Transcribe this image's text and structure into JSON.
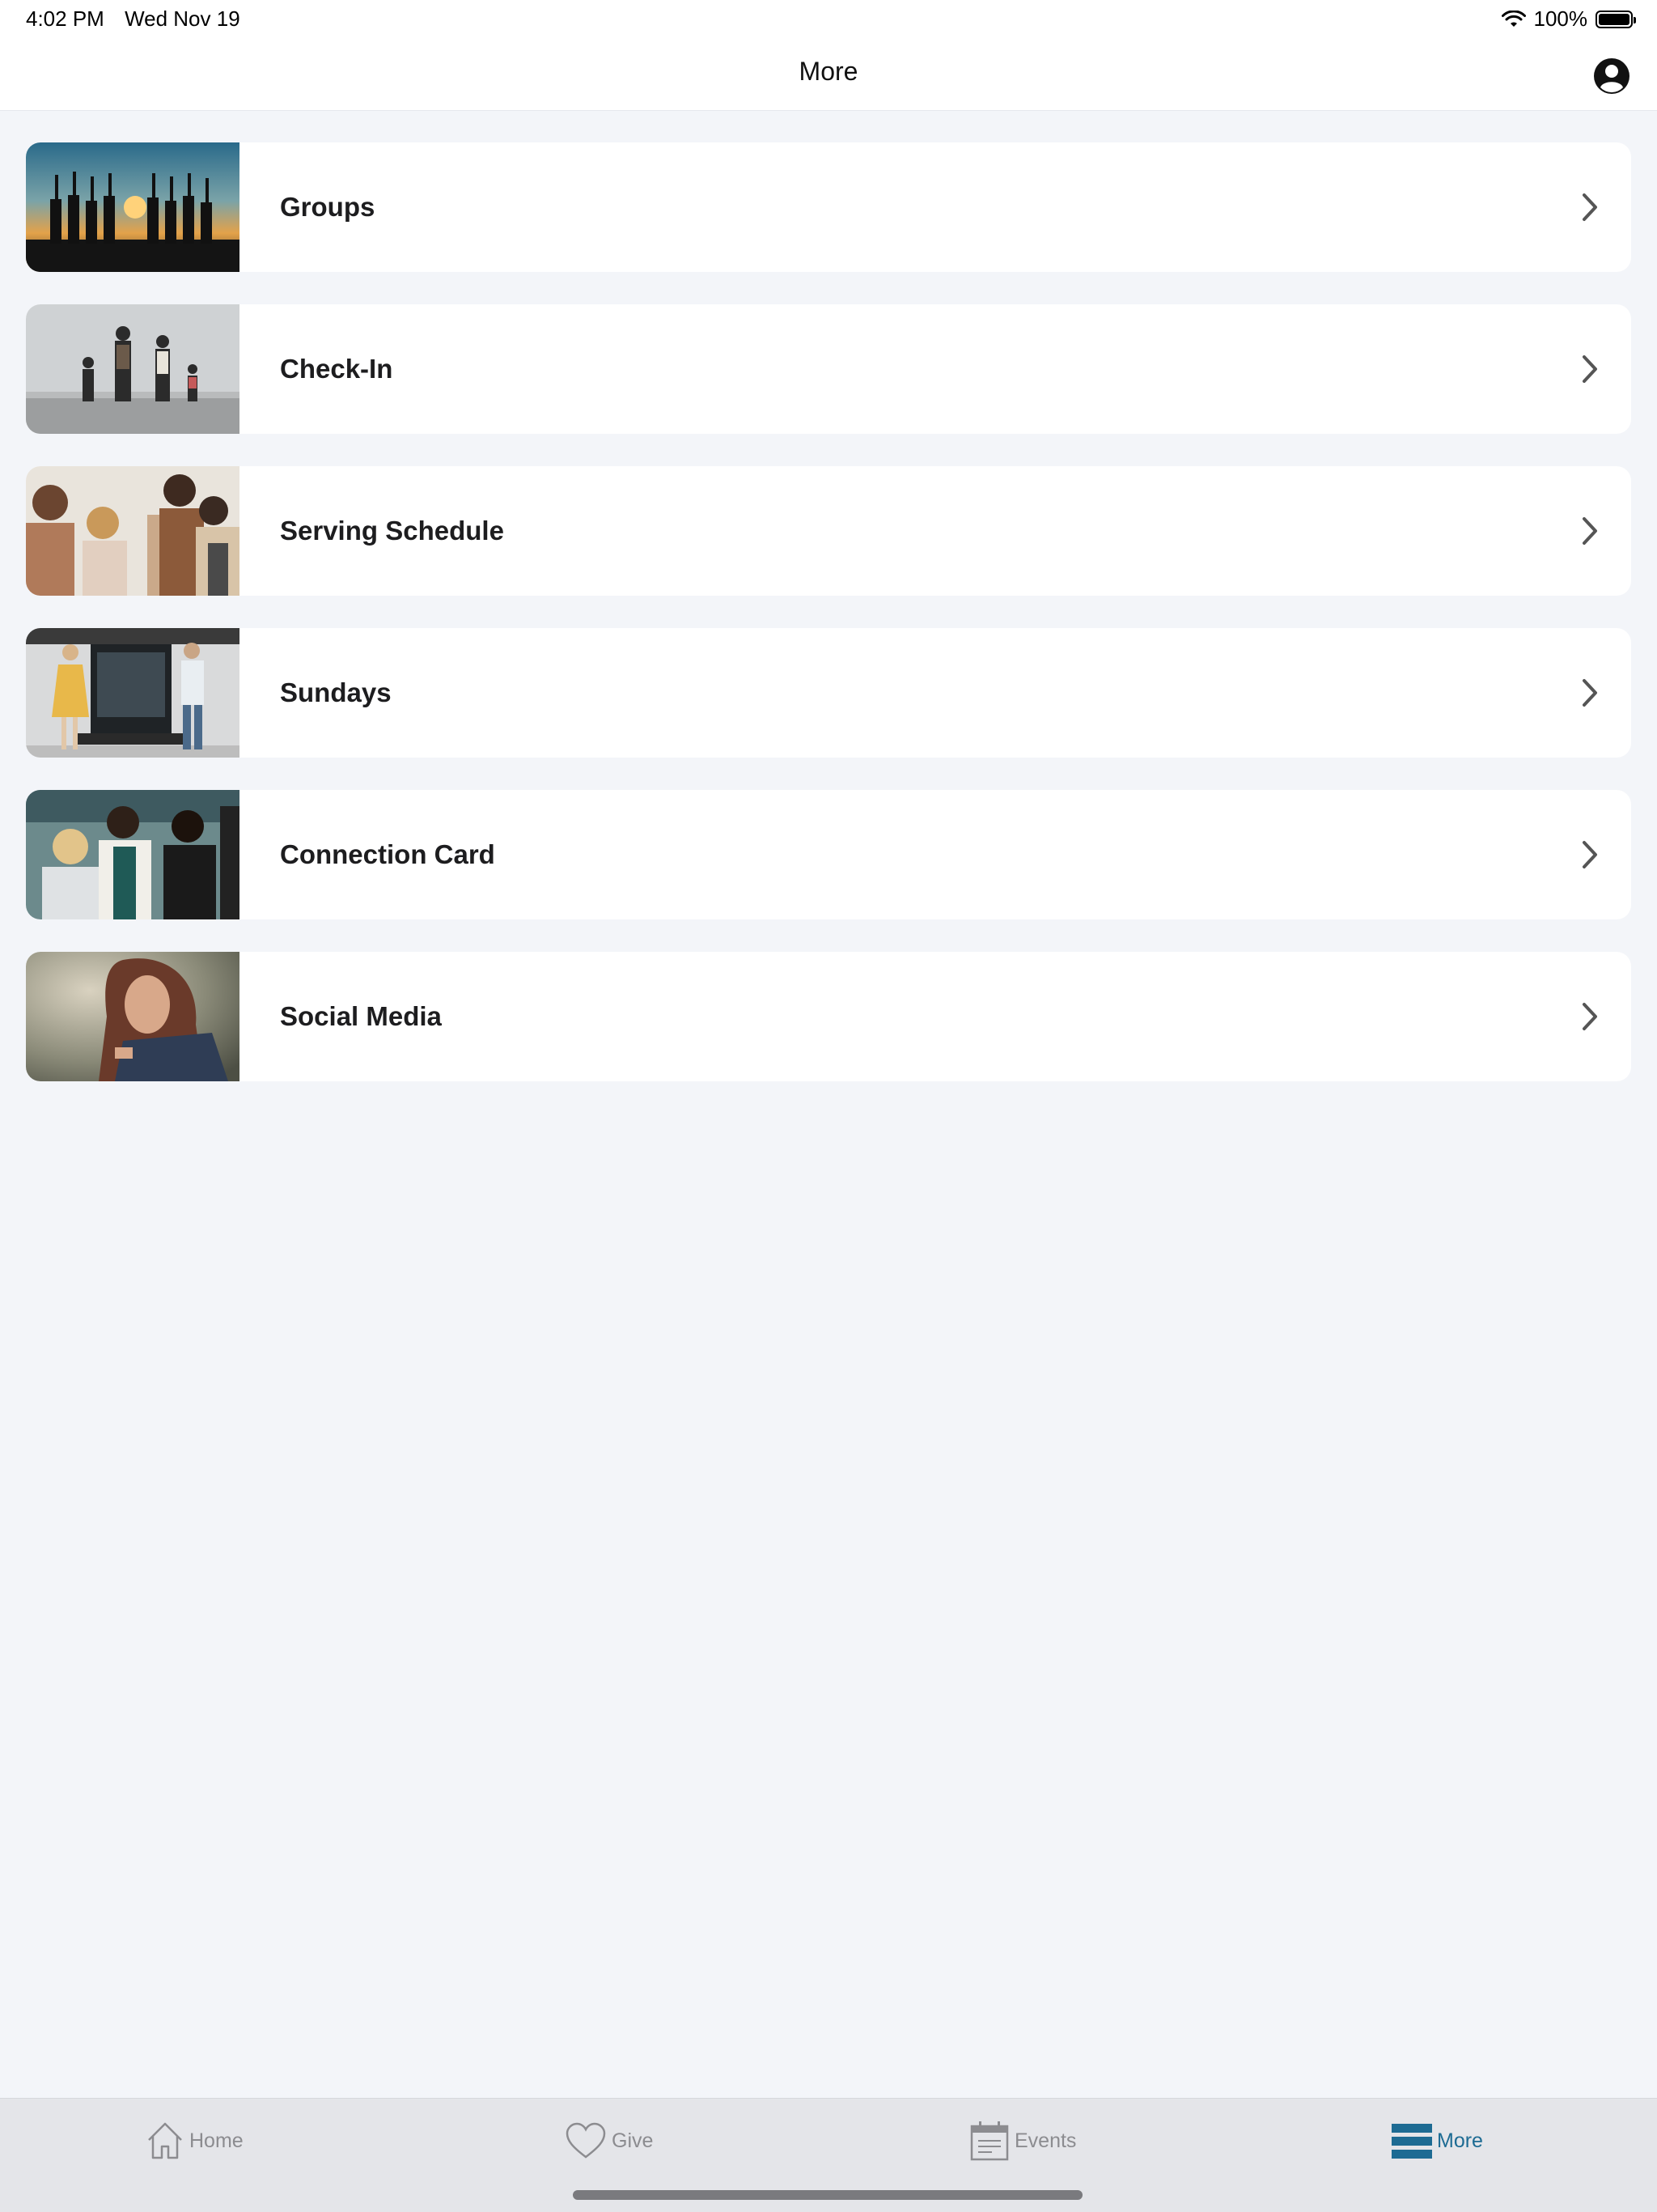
{
  "status": {
    "time": "4:02 PM",
    "date": "Wed Nov 19",
    "battery": "100%"
  },
  "header": {
    "title": "More"
  },
  "menu": {
    "items": [
      {
        "label": "Groups"
      },
      {
        "label": "Check-In"
      },
      {
        "label": "Serving Schedule"
      },
      {
        "label": "Sundays"
      },
      {
        "label": "Connection Card"
      },
      {
        "label": "Social Media"
      }
    ]
  },
  "tabs": [
    {
      "label": "Home",
      "icon": "house-icon"
    },
    {
      "label": "Give",
      "icon": "heart-icon"
    },
    {
      "label": "Events",
      "icon": "calendar-icon"
    },
    {
      "label": "More",
      "icon": "menu-icon",
      "active": true
    }
  ],
  "colors": {
    "accent": "#1d6b93",
    "background": "#f3f5f9",
    "tab_inactive": "#8c8c90"
  }
}
